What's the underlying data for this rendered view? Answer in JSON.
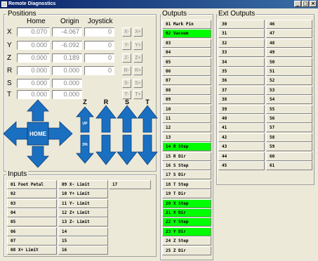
{
  "window": {
    "title": "Remote Diagnostics",
    "buttons": [
      "_",
      "□",
      "×"
    ]
  },
  "positions": {
    "title": "Positions",
    "headers": {
      "home": "Home",
      "origin": "Origin",
      "joystick": "Joystick"
    },
    "rows": [
      {
        "axis": "X",
        "home": "0.070",
        "origin": "-4.067",
        "joystick": "0",
        "minus": "X-",
        "plus": "X+"
      },
      {
        "axis": "Y",
        "home": "0.000",
        "origin": "-6.092",
        "joystick": "0",
        "minus": "Y-",
        "plus": "Y+"
      },
      {
        "axis": "Z",
        "home": "0.000",
        "origin": "0.189",
        "joystick": "0",
        "minus": "Z-",
        "plus": "Z+"
      },
      {
        "axis": "R",
        "home": "0.000",
        "origin": "0.000",
        "joystick": "0",
        "minus": "R-",
        "plus": "R+"
      },
      {
        "axis": "S",
        "home": "0.000",
        "origin": "0.000",
        "joystick": "",
        "minus": "S-",
        "plus": "S+"
      },
      {
        "axis": "T",
        "home": "0.000",
        "origin": "0.000",
        "joystick": "",
        "minus": "T-",
        "plus": "T+"
      }
    ]
  },
  "jog": {
    "home_label": "HOME",
    "axis_labels": [
      "Z",
      "R",
      "S",
      "T"
    ],
    "z_up": "UP",
    "z_dn": "DN",
    "arrow_color": "#1a6fc0"
  },
  "inputs": {
    "title": "Inputs",
    "columns": [
      [
        "01 Foot Petal",
        "02",
        "03",
        "04",
        "05",
        "06",
        "07",
        "08 X+ Limit"
      ],
      [
        "09 X- Limit",
        "10 Y+ Limit",
        "11 Y- Limit",
        "12 Z+ Limit",
        "13 Z- Limit",
        "14",
        "15",
        "16"
      ],
      [
        "17"
      ]
    ]
  },
  "outputs": {
    "title": "Outputs",
    "active_color": "#00ff00",
    "items": [
      {
        "label": "01 Mark Pin",
        "on": false
      },
      {
        "label": "02 Vacuum",
        "on": true
      },
      {
        "label": "03",
        "on": false
      },
      {
        "label": "04",
        "on": false
      },
      {
        "label": "05",
        "on": false
      },
      {
        "label": "06",
        "on": false
      },
      {
        "label": "07",
        "on": false
      },
      {
        "label": "08",
        "on": false
      },
      {
        "label": "09",
        "on": false
      },
      {
        "label": "10",
        "on": false
      },
      {
        "label": "11",
        "on": false
      },
      {
        "label": "12",
        "on": false
      },
      {
        "label": "13",
        "on": false
      },
      {
        "label": "14 R Step",
        "on": true
      },
      {
        "label": "15 R Dir",
        "on": false
      },
      {
        "label": "16 S Step",
        "on": false
      },
      {
        "label": "17 S Dir",
        "on": false
      },
      {
        "label": "18 T Step",
        "on": false
      },
      {
        "label": "19 T Dir",
        "on": false
      },
      {
        "label": "20 X Step",
        "on": true
      },
      {
        "label": "21 X Dir",
        "on": true
      },
      {
        "label": "22 Y Step",
        "on": true
      },
      {
        "label": "23 Y Dir",
        "on": true
      },
      {
        "label": "24 Z Step",
        "on": false
      },
      {
        "label": "25 Z Dir",
        "on": false
      }
    ]
  },
  "ext_outputs": {
    "title": "Ext Outputs",
    "col1": [
      "30",
      "31",
      "32",
      "33",
      "34",
      "35",
      "36",
      "37",
      "38",
      "39",
      "40",
      "41",
      "42",
      "43",
      "44",
      "45"
    ],
    "col2": [
      "46",
      "47",
      "48",
      "49",
      "50",
      "51",
      "52",
      "53",
      "54",
      "55",
      "56",
      "57",
      "58",
      "59",
      "60",
      "61"
    ]
  }
}
